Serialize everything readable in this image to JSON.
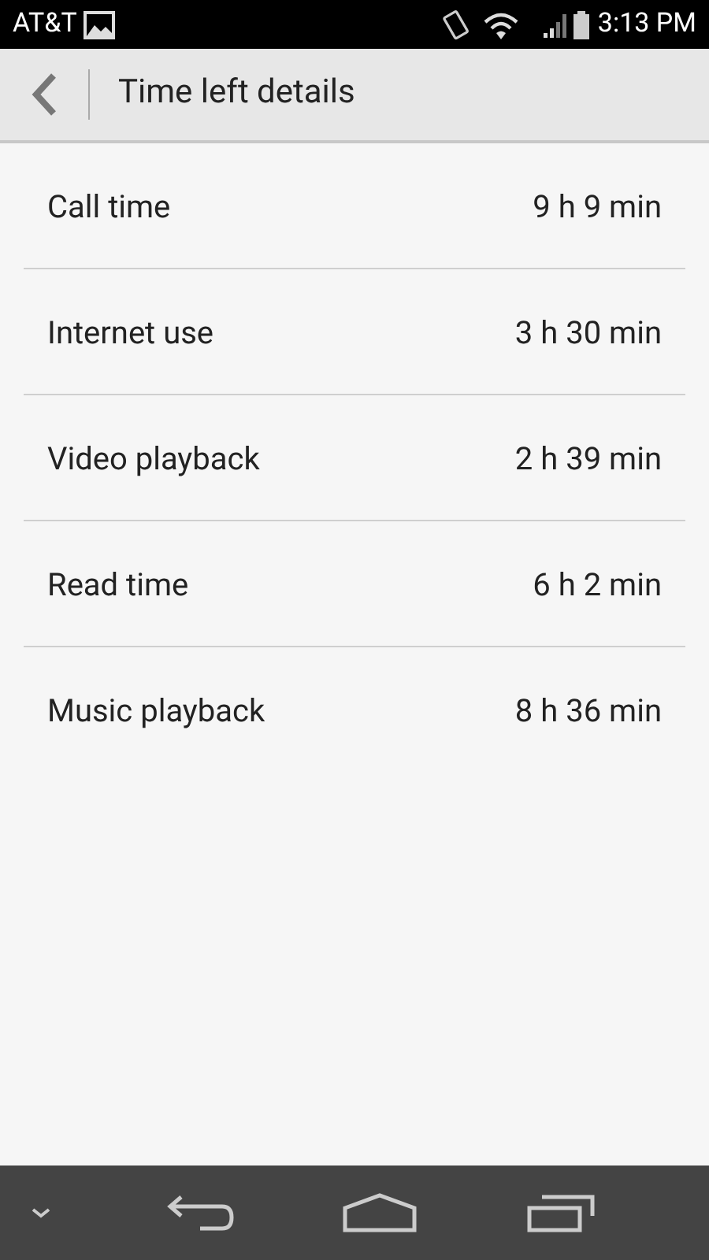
{
  "status_bar": {
    "carrier": "AT&T",
    "time": "3:13 PM"
  },
  "header": {
    "title": "Time left details"
  },
  "rows": [
    {
      "label": "Call time",
      "value": "9 h 9 min"
    },
    {
      "label": "Internet use",
      "value": "3 h 30 min"
    },
    {
      "label": "Video playback",
      "value": "2 h 39 min"
    },
    {
      "label": "Read time",
      "value": "6 h 2 min"
    },
    {
      "label": "Music playback",
      "value": "8 h 36 min"
    }
  ]
}
